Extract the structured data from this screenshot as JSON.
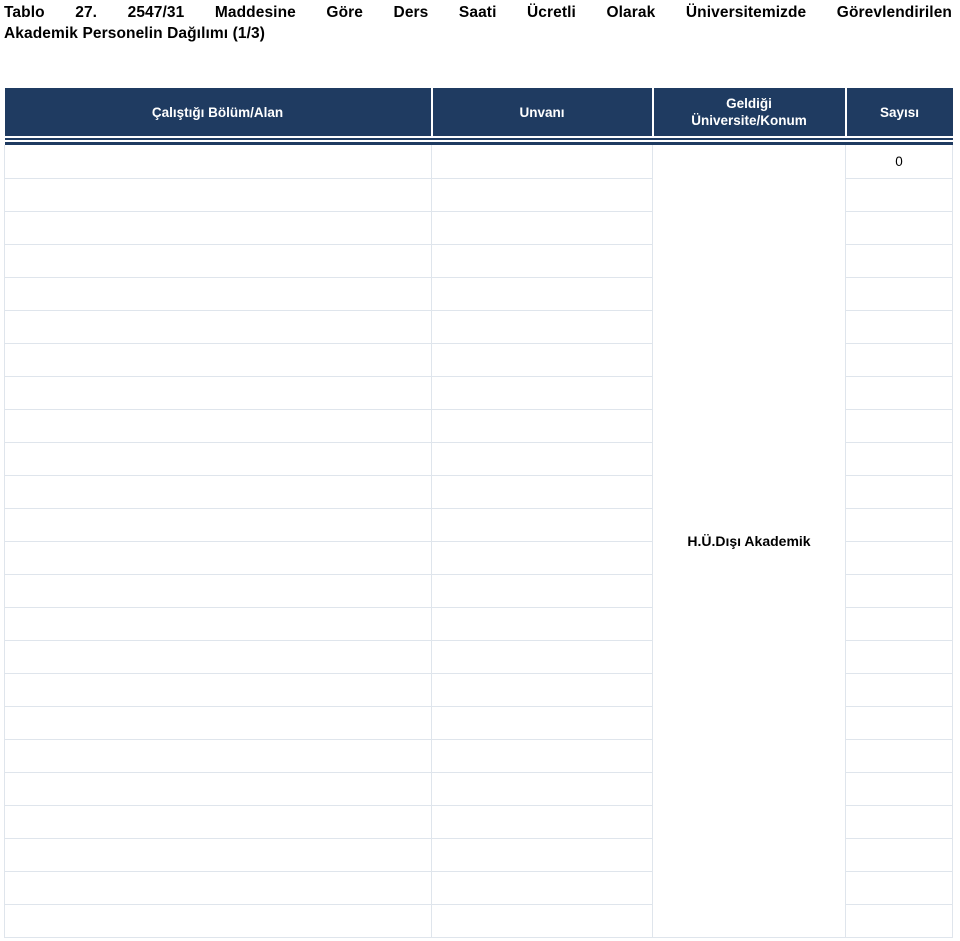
{
  "document": {
    "title_line1": "Tablo 27. 2547/31 Maddesine Göre Ders Saati Ücretli Olarak Üniversitemizde Görevlendirilen",
    "title_line2": "Akademik Personelin Dağılımı (1/3)"
  },
  "colors": {
    "header_bg": "#1f3b61",
    "header_text": "#ffffff",
    "grid_line": "#dfe5ec",
    "body_text": "#000000",
    "page_bg": "#ffffff"
  },
  "table": {
    "columns": [
      {
        "key": "department",
        "label": "Çalıştığı Bölüm/Alan",
        "align": "center"
      },
      {
        "key": "title",
        "label": "Unvanı",
        "align": "center"
      },
      {
        "key": "origin",
        "label": "Geldiği\nÜniversite/Konum",
        "align": "center"
      },
      {
        "key": "count",
        "label": "Sayısı",
        "align": "center"
      }
    ],
    "header_labels": {
      "department": "Çalıştığı Bölüm/Alan",
      "title": "Unvanı",
      "origin_line1": "Geldiği",
      "origin_line2": "Üniversite/Konum",
      "count": "Sayısı"
    },
    "merged_origin_cell": {
      "label": "H.Ü.Dışı Akademik",
      "rowspan": 24
    },
    "rows": [
      {
        "department": "",
        "title": "",
        "count": "0"
      },
      {
        "department": "",
        "title": "",
        "count": ""
      },
      {
        "department": "",
        "title": "",
        "count": ""
      },
      {
        "department": "",
        "title": "",
        "count": ""
      },
      {
        "department": "",
        "title": "",
        "count": ""
      },
      {
        "department": "",
        "title": "",
        "count": ""
      },
      {
        "department": "",
        "title": "",
        "count": ""
      },
      {
        "department": "",
        "title": "",
        "count": ""
      },
      {
        "department": "",
        "title": "",
        "count": ""
      },
      {
        "department": "",
        "title": "",
        "count": ""
      },
      {
        "department": "",
        "title": "",
        "count": ""
      },
      {
        "department": "",
        "title": "",
        "count": ""
      },
      {
        "department": "",
        "title": "",
        "count": ""
      },
      {
        "department": "",
        "title": "",
        "count": ""
      },
      {
        "department": "",
        "title": "",
        "count": ""
      },
      {
        "department": "",
        "title": "",
        "count": ""
      },
      {
        "department": "",
        "title": "",
        "count": ""
      },
      {
        "department": "",
        "title": "",
        "count": ""
      },
      {
        "department": "",
        "title": "",
        "count": ""
      },
      {
        "department": "",
        "title": "",
        "count": ""
      },
      {
        "department": "",
        "title": "",
        "count": ""
      },
      {
        "department": "",
        "title": "",
        "count": ""
      },
      {
        "department": "",
        "title": "",
        "count": ""
      },
      {
        "department": "",
        "title": "",
        "count": ""
      }
    ]
  }
}
